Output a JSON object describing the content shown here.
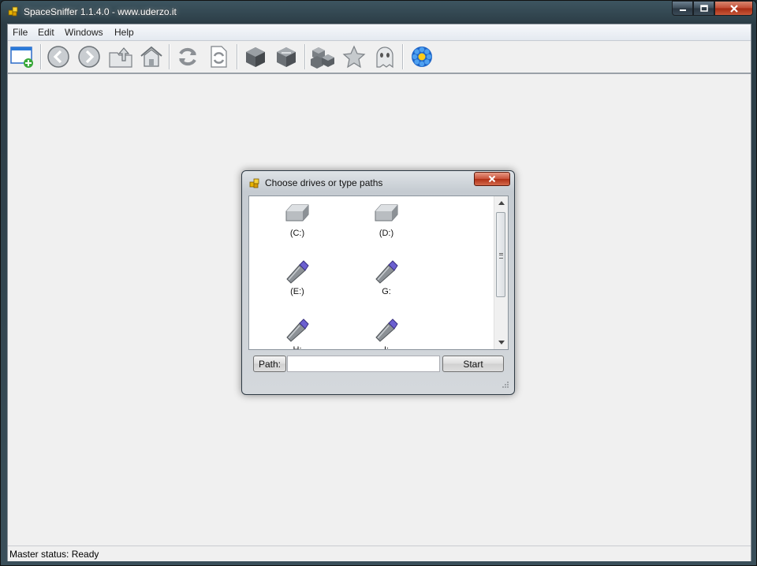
{
  "window": {
    "title": "SpaceSniffer 1.1.4.0 - www.uderzo.it",
    "caption_buttons": {
      "minimize": "–",
      "maximize": "□",
      "close": "✕"
    }
  },
  "menu": [
    {
      "label": "File"
    },
    {
      "label": "Edit"
    },
    {
      "label": "Windows"
    },
    {
      "label": "Help"
    }
  ],
  "toolbar": {
    "icons": [
      "new-window-icon",
      "back-icon",
      "forward-icon",
      "up-folder-icon",
      "home-icon",
      "refresh-icon",
      "refresh-document-icon",
      "zoom-in-cube-icon",
      "zoom-out-cube-icon",
      "cubes-icon",
      "star-icon",
      "ghost-icon",
      "flower-settings-icon"
    ]
  },
  "dialog": {
    "title": "Choose drives or type paths",
    "drives": [
      {
        "label": "(C:)",
        "icon": "hard-drive-icon"
      },
      {
        "label": "(D:)",
        "icon": "hard-drive-icon"
      },
      {
        "label": "(E:)",
        "icon": "usb-drive-icon"
      },
      {
        "label": "G:",
        "icon": "usb-drive-icon"
      },
      {
        "label": "H:",
        "icon": "usb-drive-icon"
      },
      {
        "label": "I:",
        "icon": "usb-drive-icon"
      }
    ],
    "path_label": "Path:",
    "path_value": "",
    "start_label": "Start"
  },
  "status": {
    "text": "Master status: Ready"
  },
  "colors": {
    "accent_blue": "#2a7ad8",
    "close_red": "#c9513a",
    "toolbar_gray": "#8c9095"
  }
}
